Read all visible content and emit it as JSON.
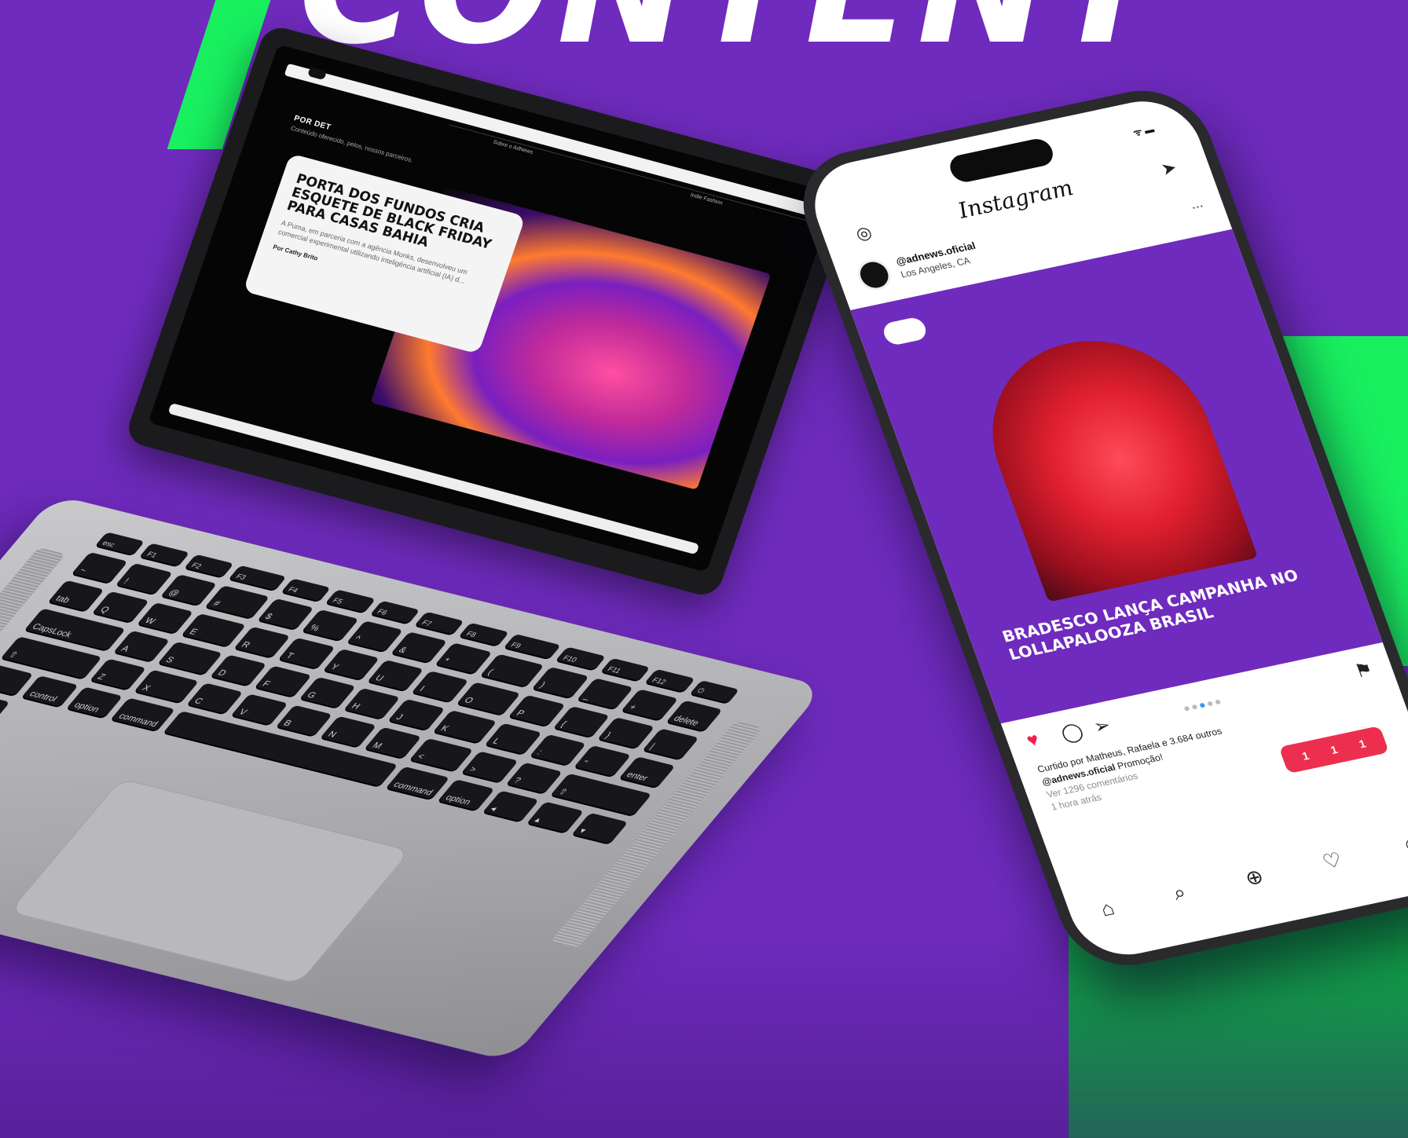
{
  "background": {
    "headline": "CONTENT",
    "colors": {
      "purple": "#6f2bbd",
      "green": "#19f060",
      "white": "#ffffff"
    }
  },
  "laptop": {
    "site": {
      "nav_items": [
        "Sobre o AdNews",
        "Indie Fashion"
      ],
      "section_title": "POR DET",
      "section_subtitle": "Conteúdo oferecido, pelos, nossos parceiros.",
      "card": {
        "title": "PORTA DOS FUNDOS CRIA ESQUETE DE BLACK FRIDAY PARA CASAS BAHIA",
        "description": "A Puma, em parceria com a agência Monks, desenvolveu um comercial experimental utilizando inteligência artificial (IA) d...",
        "author": "Por Cathy Brito"
      }
    },
    "keyboard": {
      "fn_row": [
        "esc",
        "F1",
        "F2",
        "F3",
        "F4",
        "F5",
        "F6",
        "F7",
        "F8",
        "F9",
        "F10",
        "F11",
        "F12",
        "⏻"
      ],
      "row1": [
        "~",
        "!",
        "@",
        "#",
        "$",
        "%",
        "^",
        "&",
        "*",
        "(",
        ")",
        "_",
        "+",
        "delete"
      ],
      "row2": [
        "tab",
        "Q",
        "W",
        "E",
        "R",
        "T",
        "Y",
        "U",
        "I",
        "O",
        "P",
        "{",
        "}",
        "|"
      ],
      "row3": [
        "CapsLock",
        "A",
        "S",
        "D",
        "F",
        "G",
        "H",
        "J",
        "K",
        "L",
        ":",
        "\"",
        "enter"
      ],
      "row4": [
        "⇧",
        "Z",
        "X",
        "C",
        "V",
        "B",
        "N",
        "M",
        "<",
        ">",
        "?",
        "⇧"
      ],
      "row5": [
        "fn",
        "control",
        "option",
        "command",
        "",
        "command",
        "option",
        "◂",
        "▴",
        "▾",
        "▸"
      ]
    }
  },
  "phone": {
    "status_signal": "ᯤ ▬",
    "app_logo": "Instagram",
    "icons": {
      "camera": "camera-icon",
      "send": "send-icon"
    },
    "post": {
      "username": "@adnews.oficial",
      "location": "Los Angeles, CA",
      "more": "...",
      "media_title": "BRADESCO LANÇA CAMPANHA NO LOLLAPALOOZA BRASIL",
      "liked_by": "Curtido por Matheus, Rafaela e 3.684 outros",
      "caption_user": "@adnews.oficial",
      "caption_text": "Promoção!",
      "comments": "Ver 1296 comentários",
      "time": "1 hora atrás"
    },
    "notification": {
      "comments": "1",
      "likes": "1",
      "followers": "1"
    },
    "tabs": [
      "home-icon",
      "search-icon",
      "add-icon",
      "heart-icon",
      "profile-icon"
    ]
  }
}
